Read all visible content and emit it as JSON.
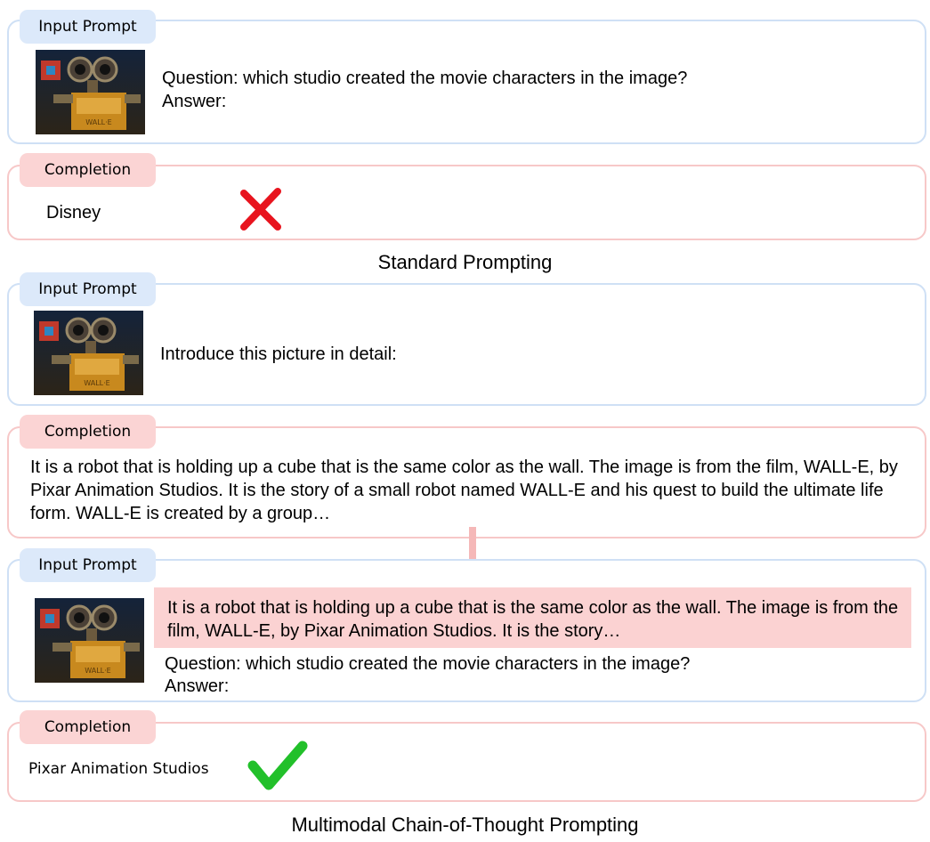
{
  "standard": {
    "input_tag": "Input Prompt",
    "question": "Question: which studio created the movie characters in the image?",
    "answer_label": "Answer:",
    "completion_tag": "Completion",
    "completion": "Disney",
    "result_icon": "cross-icon",
    "caption": "Standard Prompting"
  },
  "cot": {
    "step1_input_tag": "Input Prompt",
    "step1_prompt": "Introduce this picture in detail:",
    "step1_completion_tag": "Completion",
    "step1_completion": "It is a robot that is holding up a cube that is the same color as the wall. The image is from the film, WALL-E, by Pixar Animation Studios. It is the story of a small robot named WALL-E and his quest to build the ultimate life form. WALL-E is created by a group…",
    "step2_input_tag": "Input Prompt",
    "step2_rationale": "It is a robot that is holding up a cube that is the same color as the wall. The image is from the film, WALL-E, by Pixar Animation Studios. It is the story…",
    "step2_question": "Question: which studio created the movie characters in the image?",
    "step2_answer_label": "Answer:",
    "step2_completion_tag": "Completion",
    "step2_completion": "Pixar Animation Studios",
    "result_icon": "check-icon",
    "caption": "Multimodal Chain-of-Thought Prompting"
  },
  "image_text": "WALL·E",
  "colors": {
    "input_border": "#cfe0f5",
    "input_tag": "#dce9fa",
    "completion_border": "#f7c8c8",
    "completion_tag": "#fbd4d4",
    "highlight": "#fbd2d2",
    "cross": "#e8141e",
    "check": "#22c02a",
    "arrow": "#f5b8b8"
  }
}
